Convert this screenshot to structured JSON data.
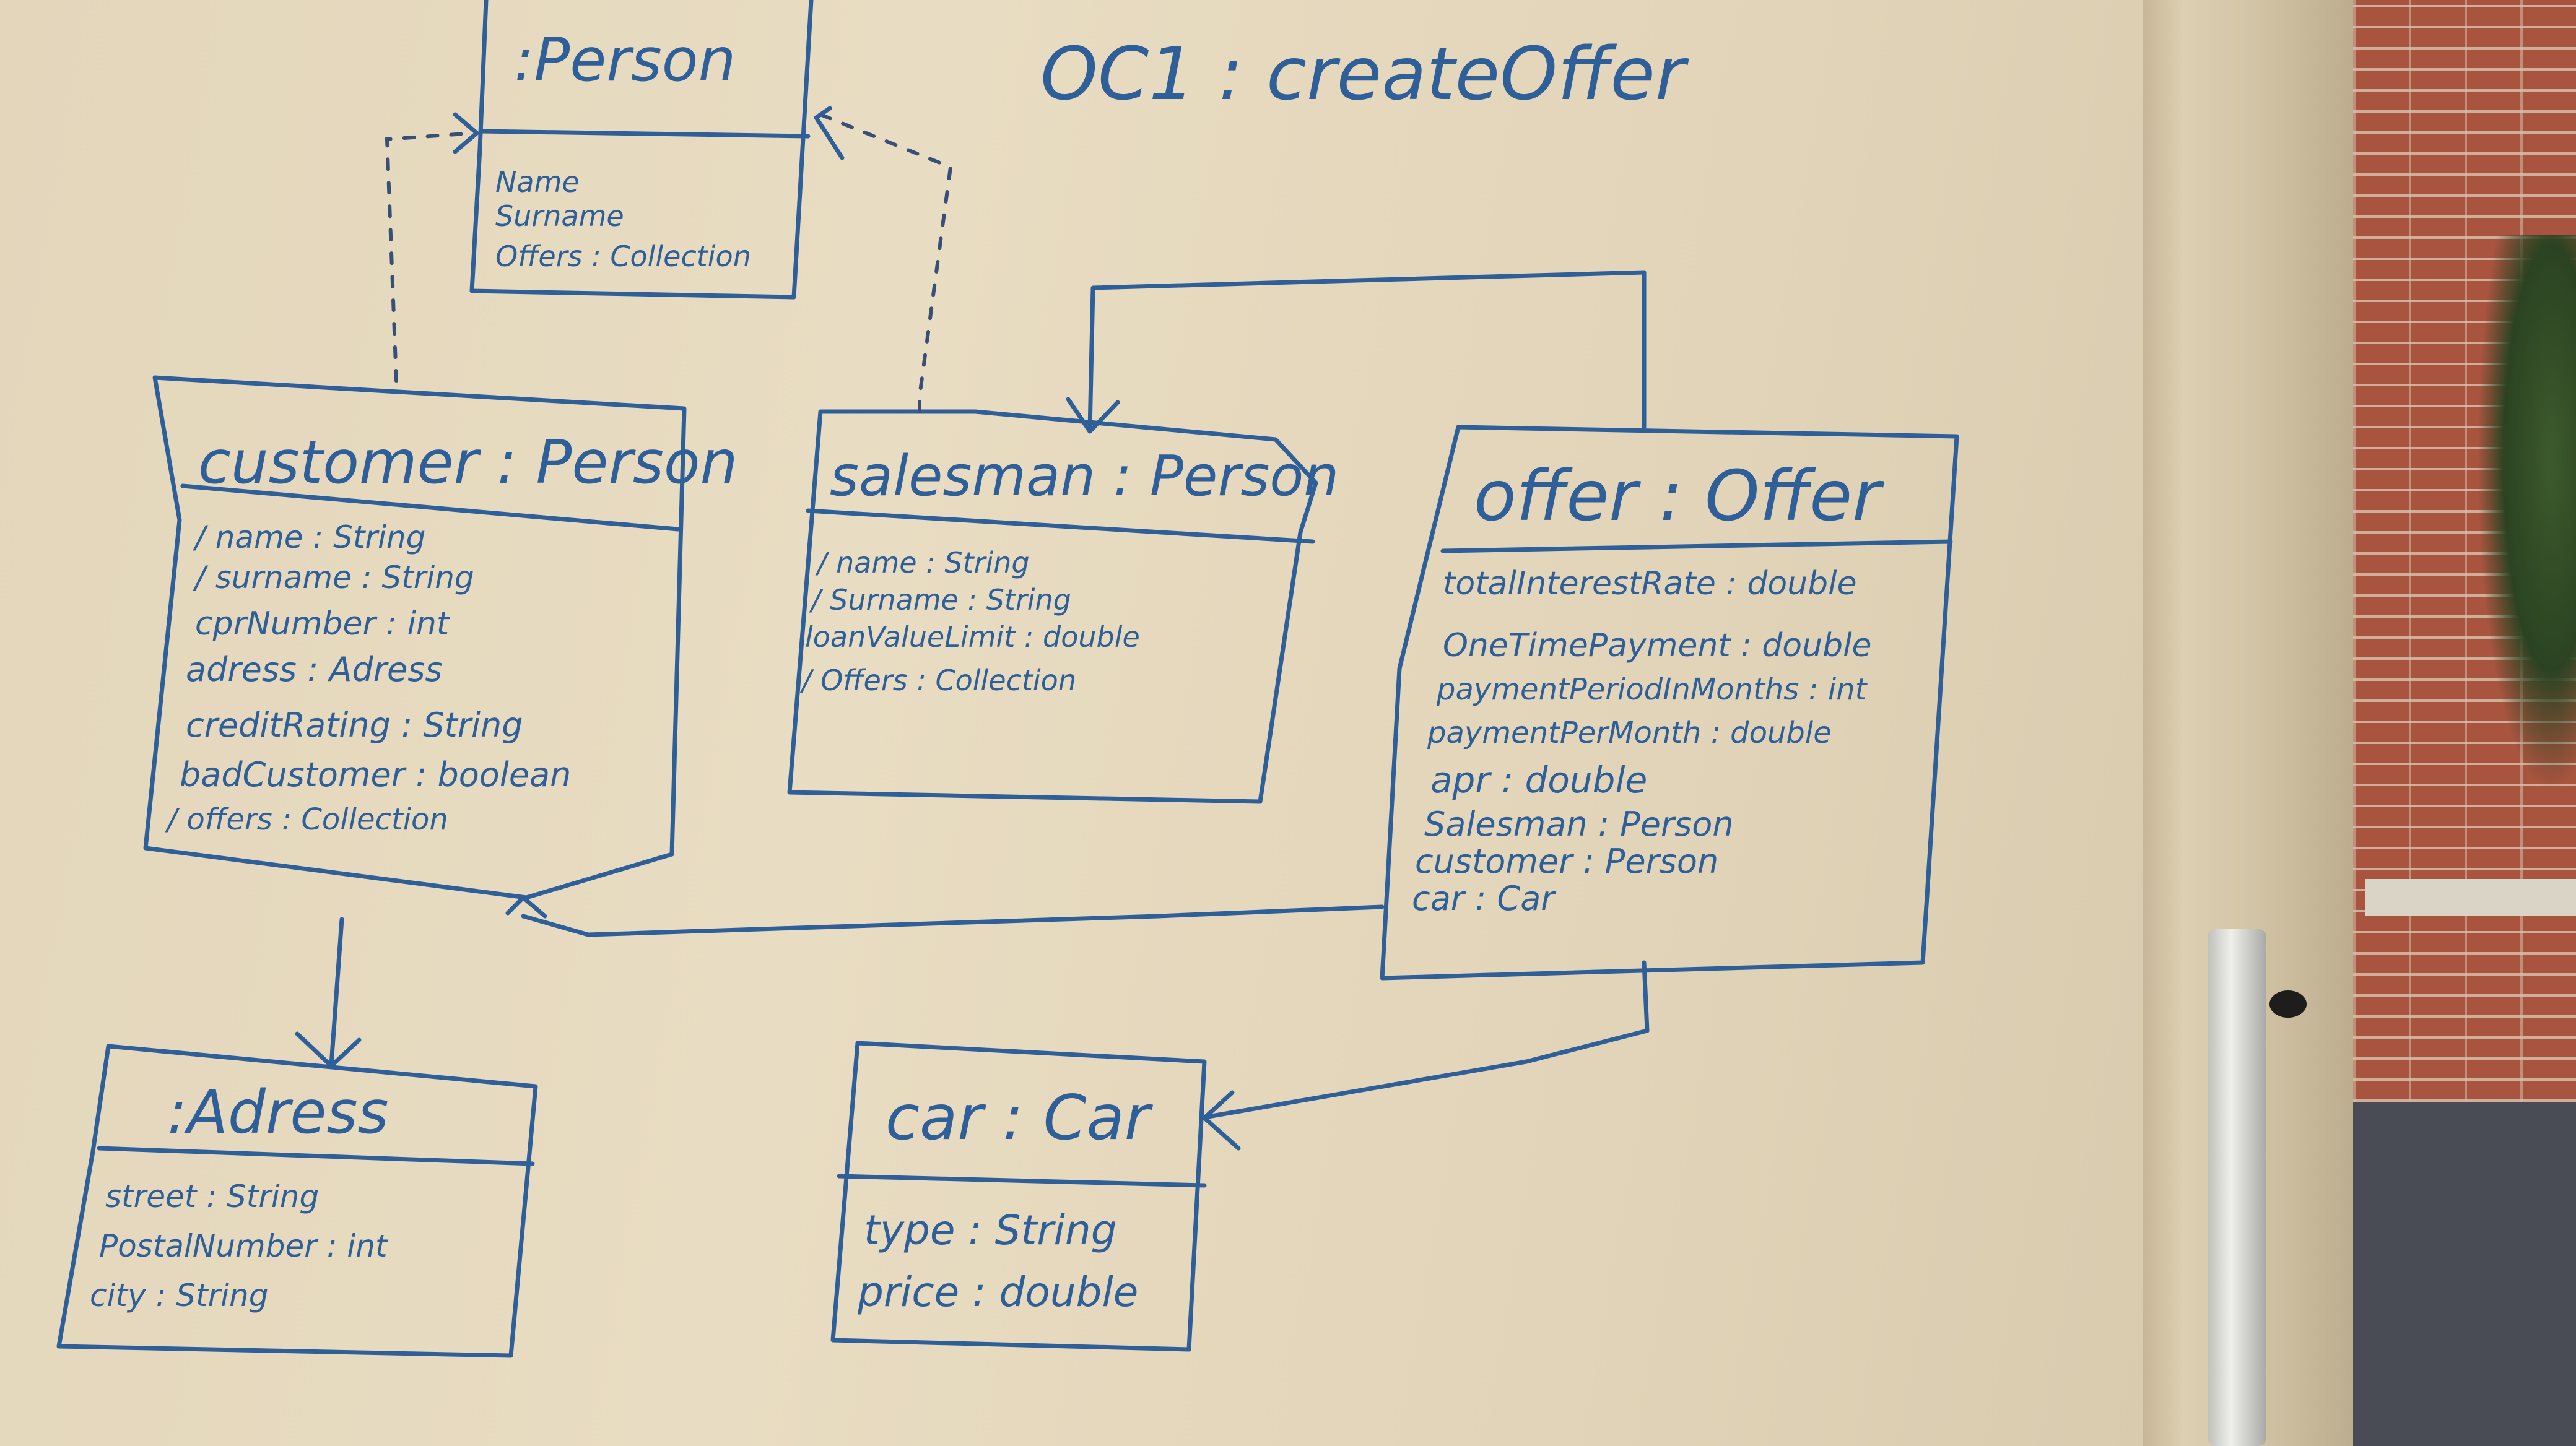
{
  "title": "OC1 : createOffer",
  "colors": {
    "ink": "#2f5f98",
    "board": "#e6d9bd"
  },
  "objects": {
    "person": {
      "header": ":Person",
      "attributes": [
        "Name",
        "Surname",
        "Offers : Collection"
      ]
    },
    "customer": {
      "header": "customer : Person",
      "attributes": [
        "/ name : String",
        "/ surname : String",
        "cprNumber : int",
        "adress : Adress",
        "creditRating : String",
        "badCustomer : boolean",
        "/ offers : Collection"
      ]
    },
    "salesman": {
      "header": "salesman : Person",
      "attributes": [
        "/ name : String",
        "/ Surname : String",
        "loanValueLimit : double",
        "/ Offers : Collection"
      ]
    },
    "offer": {
      "header": "offer : Offer",
      "attributes": [
        "totalInterestRate : double",
        "OneTimePayment : double",
        "paymentPeriodInMonths : int",
        "paymentPerMonth : double",
        "apr : double",
        "Salesman : Person",
        "customer : Person",
        "car : Car"
      ]
    },
    "adress": {
      "header": ":Adress",
      "attributes": [
        "street : String",
        "PostalNumber : int",
        "city : String"
      ]
    },
    "car": {
      "header": "car : Car",
      "attributes": [
        "type : String",
        "price : double"
      ]
    }
  }
}
